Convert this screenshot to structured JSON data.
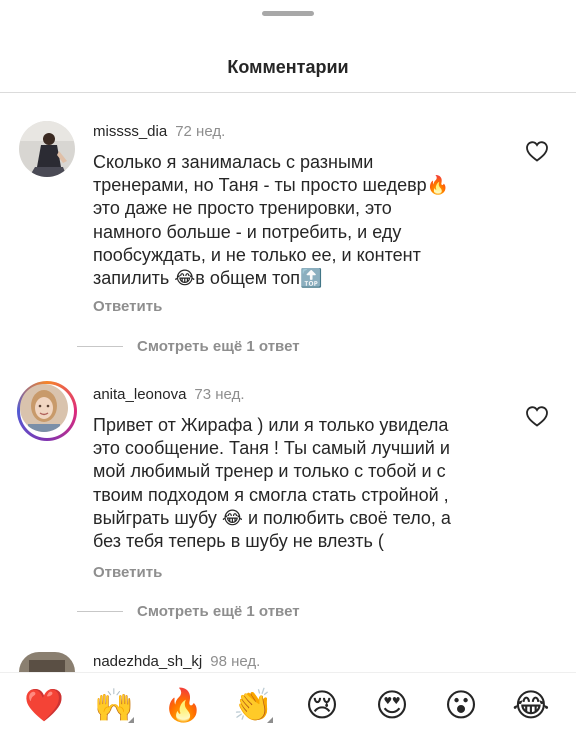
{
  "header": {
    "title": "Комментарии"
  },
  "comments": [
    {
      "username": "missss_dia",
      "time": "72 нед.",
      "text_lines": [
        "Сколько я занималась с разными",
        "тренерами, но Таня - ты просто шедевр🔥",
        "это даже не просто тренировки, это",
        "намного больше - и потребить, и еду",
        "пообсуждать, и не только ее, и контент",
        "запилить 😂в общем топ🔝"
      ],
      "reply_label": "Ответить",
      "view_replies": "Смотреть ещё 1 ответ"
    },
    {
      "username": "anita_leonova",
      "time": "73 нед.",
      "text_lines": [
        "Привет от Жирафа ) или я только увидела",
        "это сообщение. Таня ! Ты самый лучший и",
        "мой любимый тренер и только с тобой и с",
        "твоим подходом я смогла стать стройной ,",
        "выйграть шубу 😂 и полюбить своё тело, а",
        "без тебя теперь в шубу не влезть ("
      ],
      "reply_label": "Ответить",
      "view_replies": "Смотреть ещё 1 ответ"
    },
    {
      "username": "nadezhda_sh_kj",
      "time": "98 нед."
    }
  ],
  "reactions": [
    "❤️",
    "🙌",
    "🔥",
    "👏",
    "😢",
    "😍",
    "😮",
    "😂"
  ]
}
